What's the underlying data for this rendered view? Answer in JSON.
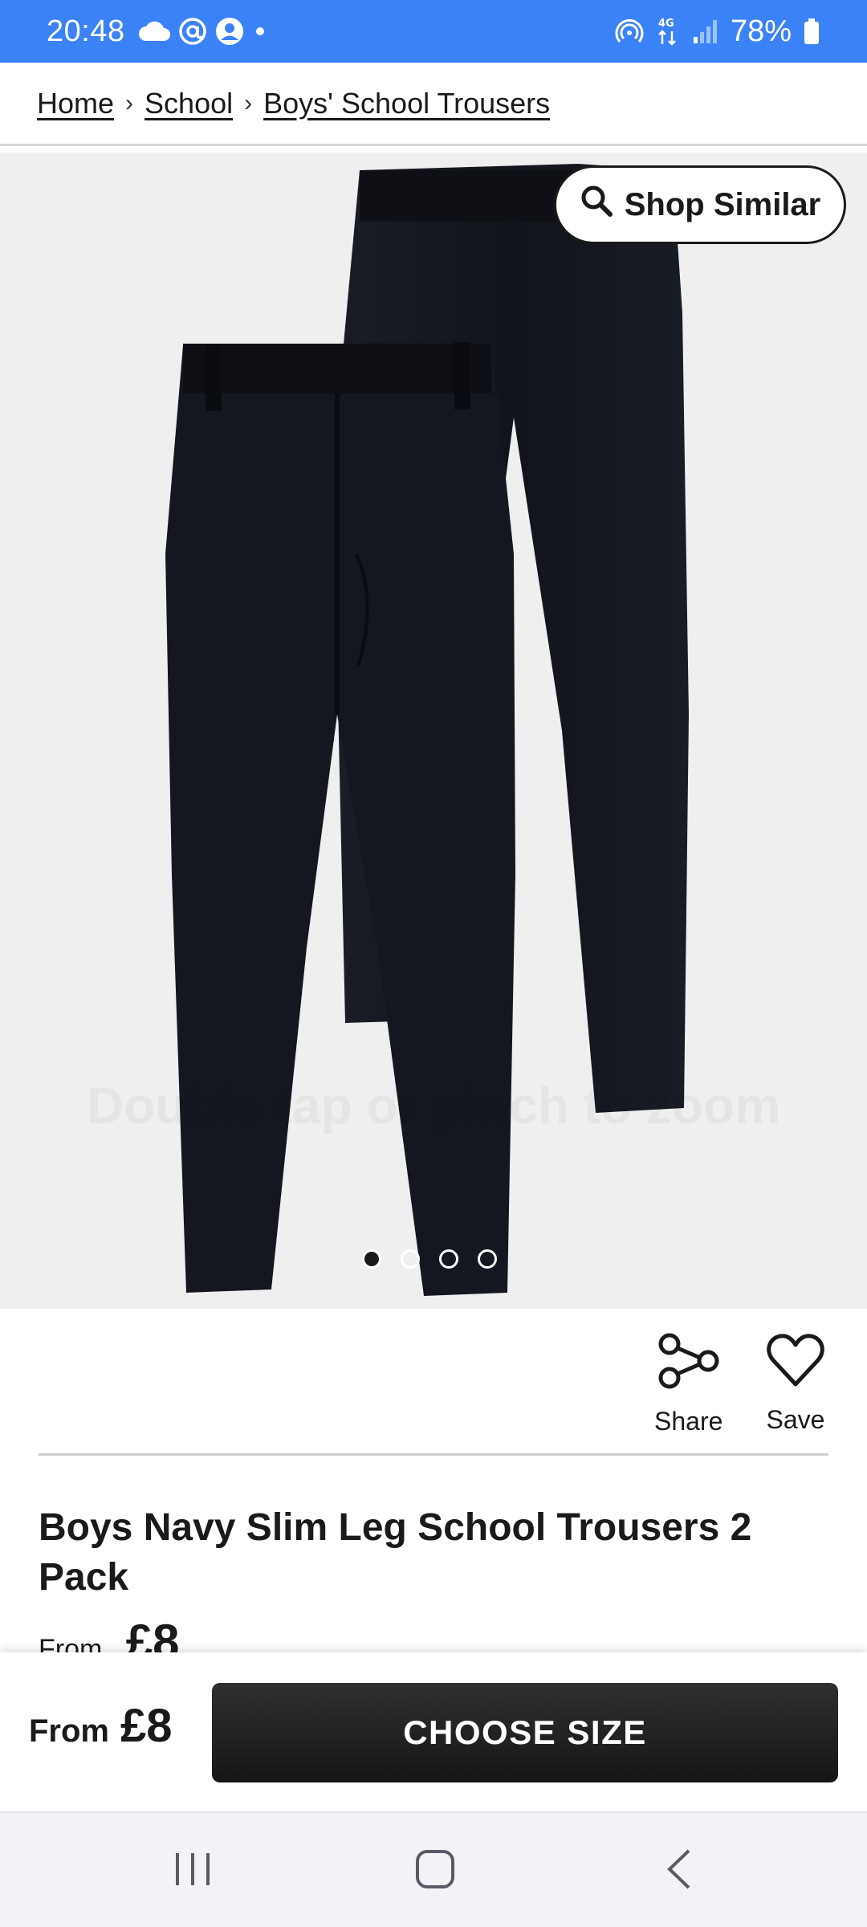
{
  "status_bar": {
    "time": "20:48",
    "battery": "78%",
    "network": "4G"
  },
  "breadcrumb": {
    "items": [
      "Home",
      "School",
      "Boys' School Trousers"
    ],
    "separator": "›"
  },
  "hero": {
    "shop_similar_label": "Shop Similar",
    "watermark": "Double tap or pinch to zoom",
    "carousel": {
      "count": 4,
      "active": 1
    },
    "background": "#efefef",
    "product_color": "#14161e"
  },
  "actions": {
    "share_label": "Share",
    "save_label": "Save"
  },
  "product": {
    "title": "Boys Navy Slim Leg School Trousers 2 Pack",
    "price_prefix": "From",
    "price": "£8"
  },
  "sticky_bar": {
    "price_prefix": "From",
    "price": "£8",
    "cta_label": "CHOOSE SIZE"
  },
  "colors": {
    "status_bar": "#3b82f6",
    "cta_background": "#1f1f1f",
    "text": "#1a1a1a"
  }
}
